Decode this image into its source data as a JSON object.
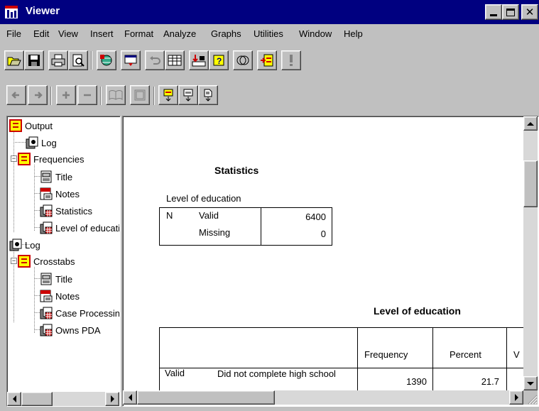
{
  "window": {
    "title": "Viewer"
  },
  "menu": [
    "File",
    "Edit",
    "View",
    "Insert",
    "Format",
    "Analyze",
    "Graphs",
    "Utilities",
    "Window",
    "Help"
  ],
  "toolbar1": {
    "buttons": [
      "open-icon",
      "save-icon",
      "print-icon",
      "print-preview-icon",
      "export-icon",
      "dialog-recall-icon",
      "undo-icon",
      "goto-data-icon",
      "goto-case-icon",
      "variables-icon",
      "use-sets-icon",
      "designate-window-icon",
      "run-icon"
    ]
  },
  "toolbar2": {
    "buttons": [
      "promote-icon",
      "demote-icon",
      "expand-icon",
      "collapse-icon",
      "show-icon",
      "hide-icon",
      "insert-heading-icon",
      "insert-title-icon",
      "insert-text-icon"
    ]
  },
  "outline": {
    "items": [
      {
        "label": "Output",
        "icon": "output-book-icon"
      },
      {
        "label": "Log",
        "icon": "log-icon"
      },
      {
        "label": "Frequencies",
        "icon": "output-book-icon"
      },
      {
        "label": "Title",
        "icon": "title-icon"
      },
      {
        "label": "Notes",
        "icon": "notes-icon"
      },
      {
        "label": "Statistics",
        "icon": "pivot-table-icon"
      },
      {
        "label": "Level of education",
        "icon": "pivot-table-icon"
      },
      {
        "label": "Log",
        "icon": "log-icon"
      },
      {
        "label": "Crosstabs",
        "icon": "output-book-icon"
      },
      {
        "label": "Title",
        "icon": "title-icon"
      },
      {
        "label": "Notes",
        "icon": "notes-icon"
      },
      {
        "label": "Case Processing Summary",
        "icon": "pivot-table-icon"
      },
      {
        "label": "Owns PDA",
        "icon": "pivot-table-icon"
      }
    ]
  },
  "statistics": {
    "title": "Statistics",
    "variable": "Level of education",
    "rows": [
      {
        "stat": "N",
        "type": "Valid",
        "value": "6400"
      },
      {
        "stat": "",
        "type": "Missing",
        "value": "0"
      }
    ]
  },
  "frequency_table": {
    "title": "Level of education",
    "headers": [
      "Frequency",
      "Percent",
      "V"
    ],
    "rows": [
      {
        "group": "Valid",
        "label": "Did not complete high school",
        "frequency": "1390",
        "percent": "21.7"
      }
    ]
  }
}
